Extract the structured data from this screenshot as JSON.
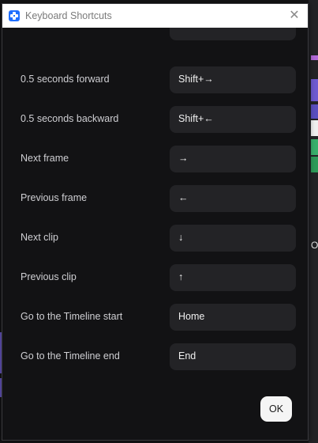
{
  "window": {
    "title": "Keyboard Shortcuts",
    "close_glyph": "✕",
    "app_icon": "app-logo-icon",
    "close_icon": "close-icon"
  },
  "background": {
    "right_edge_letter": "O"
  },
  "shortcuts": [
    {
      "label": "",
      "key": ""
    },
    {
      "label": "0.5 seconds forward",
      "key": "Shift+→"
    },
    {
      "label": "0.5 seconds backward",
      "key": "Shift+←"
    },
    {
      "label": "Next frame",
      "key": "→"
    },
    {
      "label": "Previous frame",
      "key": "←"
    },
    {
      "label": "Next clip",
      "key": "↓"
    },
    {
      "label": "Previous clip",
      "key": "↑"
    },
    {
      "label": "Go to the Timeline start",
      "key": "Home"
    },
    {
      "label": "Go to the Timeline end",
      "key": "End"
    }
  ],
  "footer": {
    "ok_label": "OK"
  },
  "colors": {
    "dialog_bg": "#121214",
    "key_bg": "#232326",
    "titlebar_bg": "#ffffff",
    "accent": "#1f6fff"
  }
}
